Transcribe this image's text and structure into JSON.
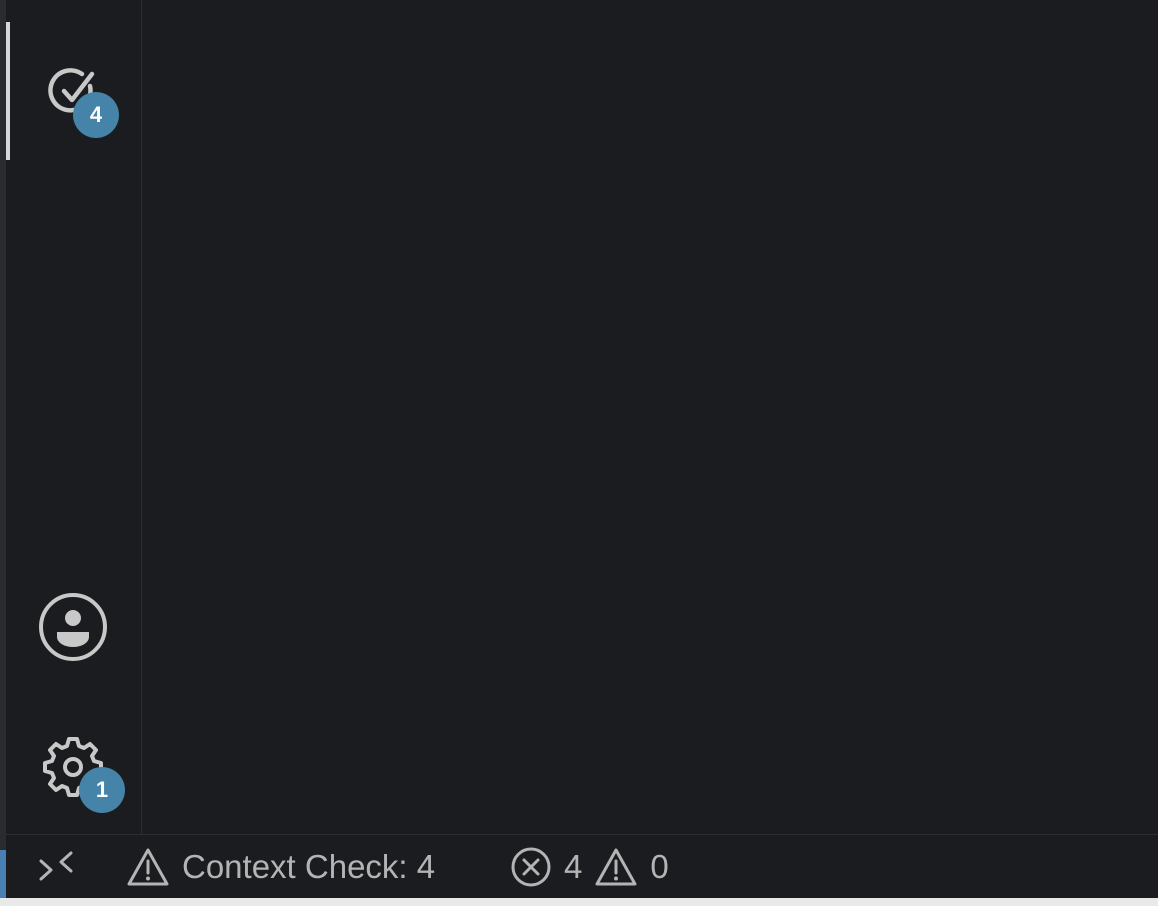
{
  "colors": {
    "background": "#1b1c1f",
    "icon": "#c8c8c8",
    "badge": "#4583a8",
    "badge_text": "#ffffff",
    "status_text": "#b4b4b4"
  },
  "activity_bar": {
    "items": [
      {
        "icon": "check-circle-icon",
        "badge": "4"
      },
      {
        "icon": "account-icon"
      },
      {
        "icon": "gear-icon",
        "badge": "1"
      }
    ]
  },
  "status_bar": {
    "remote_icon": "remote-icon",
    "context_check_label": "Context Check: 4",
    "errors_count": "4",
    "warnings_count": "0"
  }
}
